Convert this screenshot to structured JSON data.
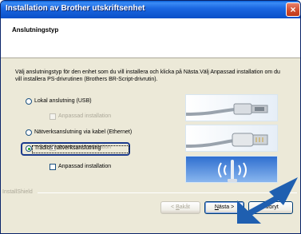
{
  "window": {
    "title": "Installation av Brother utskriftsenhet",
    "close_glyph": "×"
  },
  "header": {
    "title": "Anslutningstyp"
  },
  "instructions": "Välj anslutningstyp för den enhet som du vill installera och klicka på Nästa.Välj Anpassad installation om du vill installera PS-drivrutinen (Brothers BR-Script-drivrutin).",
  "options": [
    {
      "label": "Lokal anslutning (USB)",
      "selected": false,
      "custom_install_label": "Anpassad installation",
      "custom_install_enabled": false,
      "icon": "usb-cable-icon"
    },
    {
      "label": "Nätverksanslutning via kabel (Ethernet)",
      "selected": false,
      "custom_install_label": "Anpassad installation",
      "custom_install_enabled": false,
      "icon": "ethernet-cable-icon"
    },
    {
      "label": "Trådlös nätverksanslutning",
      "selected": true,
      "custom_install_label": "Anpassad installation",
      "custom_install_enabled": true,
      "icon": "wireless-antenna-icon"
    }
  ],
  "footer": {
    "installshield": "InstallShield",
    "back_mnemonic": "B",
    "back_rest": "akåt",
    "back_prefix": "< ",
    "next_mnemonic": "N",
    "next_rest": "ästa >",
    "cancel": "Avbryt"
  },
  "colors": {
    "titlebar": "#0a5fd8",
    "focus_border": "#1b3a8c",
    "arrow": "#1f5fb0"
  }
}
